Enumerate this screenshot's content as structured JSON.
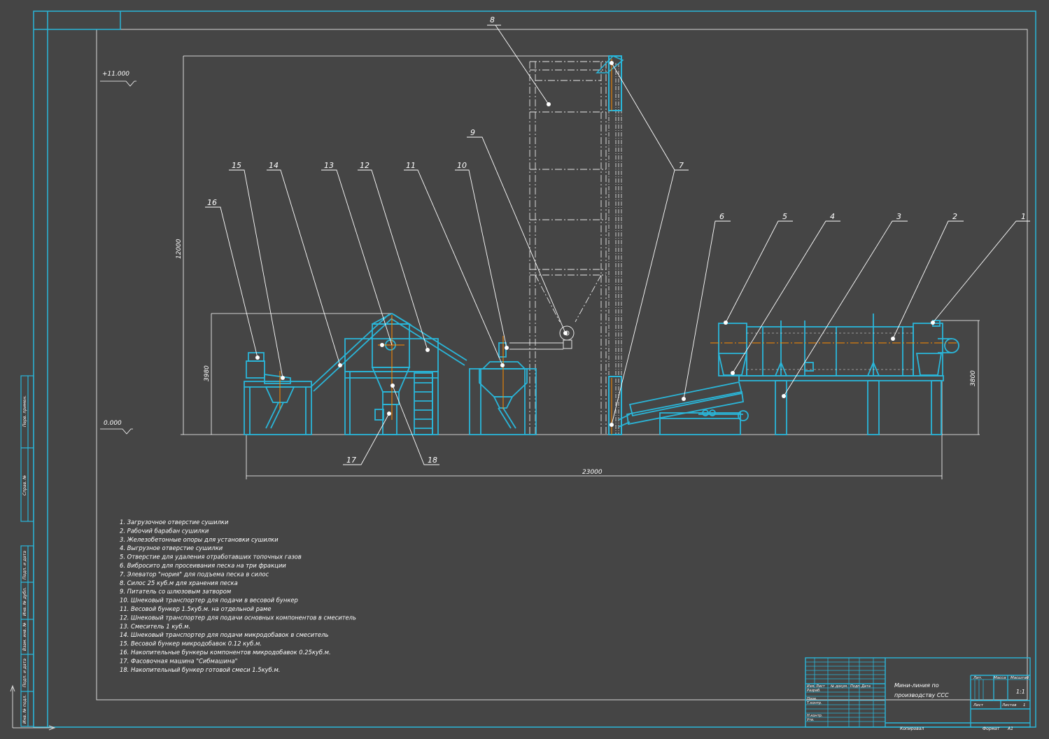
{
  "elevation": {
    "top_mark": "+11.000",
    "zero_mark": "0.000"
  },
  "dimensions": {
    "total_height": "12000",
    "left_group_height": "3980",
    "right_group_height": "3800",
    "total_length": "23000"
  },
  "callouts": [
    "1",
    "2",
    "3",
    "4",
    "5",
    "6",
    "7",
    "8",
    "9",
    "10",
    "11",
    "12",
    "13",
    "14",
    "15",
    "16",
    "17",
    "18"
  ],
  "legend": [
    "1. Загрузочное отверстие сушилки",
    "2. Рабочий барабан сушилки",
    "3. Железобетонные опоры для установки сушилки",
    "4. Выгрузное отверстие сушилки",
    "5. Отверстие для удаления отработавших топочных газов",
    "6. Вибросито для просеивания песка на три фракции",
    "7. Элеватор \"нория\" для подъема песка в силос",
    "8. Силос 25 куб.м для хранения песка",
    "9. Питатель со шлюзовым затвором",
    "10. Шнековый транспортер для подачи в весовой бункер",
    "11. Весовой бункер 1.5куб.м. на отдельной раме",
    "12. Шнековый транспортер для подачи основных компонентов в смеситель",
    "13. Смеситель 1 куб.м.",
    "14. Шнековый транспортер для подачи микродобавок в смеситель",
    "15. Весовой бункер микродобавок 0.12 куб.м.",
    "16. Накопительные бункеры компонентов микродобавок 0.25куб.м.",
    "17. Фасовочная машина \"Сибмашина\"",
    "18. Накопительный бункер готовой смеси 1.5куб.м."
  ],
  "side_stamp": [
    "Перв. примен.",
    "Справ. №",
    "Подп. и дата",
    "Инв. № дубл.",
    "Взам. инв. №",
    "Подп. и дата",
    "Инв. № подл."
  ],
  "title_block": {
    "title_line1": "Мини-линия по",
    "title_line2": "производству ССС",
    "row_labels": [
      "Изм.",
      "Лист",
      "№ докум.",
      "Подп.",
      "Дата"
    ],
    "role_labels": [
      "Разраб.",
      "Пров.",
      "Т.контр.",
      "Н.контр.",
      "Утв."
    ],
    "col_heads": [
      "Лит.",
      "Масса",
      "Масштаб"
    ],
    "scale": "1:1",
    "sheet_label": "Лист",
    "sheets_label": "Листов",
    "sheets_value": "1",
    "copied": "Копировал",
    "format": "Формат",
    "format_value": "A1"
  },
  "colors": {
    "background": "#454545",
    "frame": "#2ab6d9",
    "lines": "#ffffff",
    "axis": "#ff8a00"
  }
}
